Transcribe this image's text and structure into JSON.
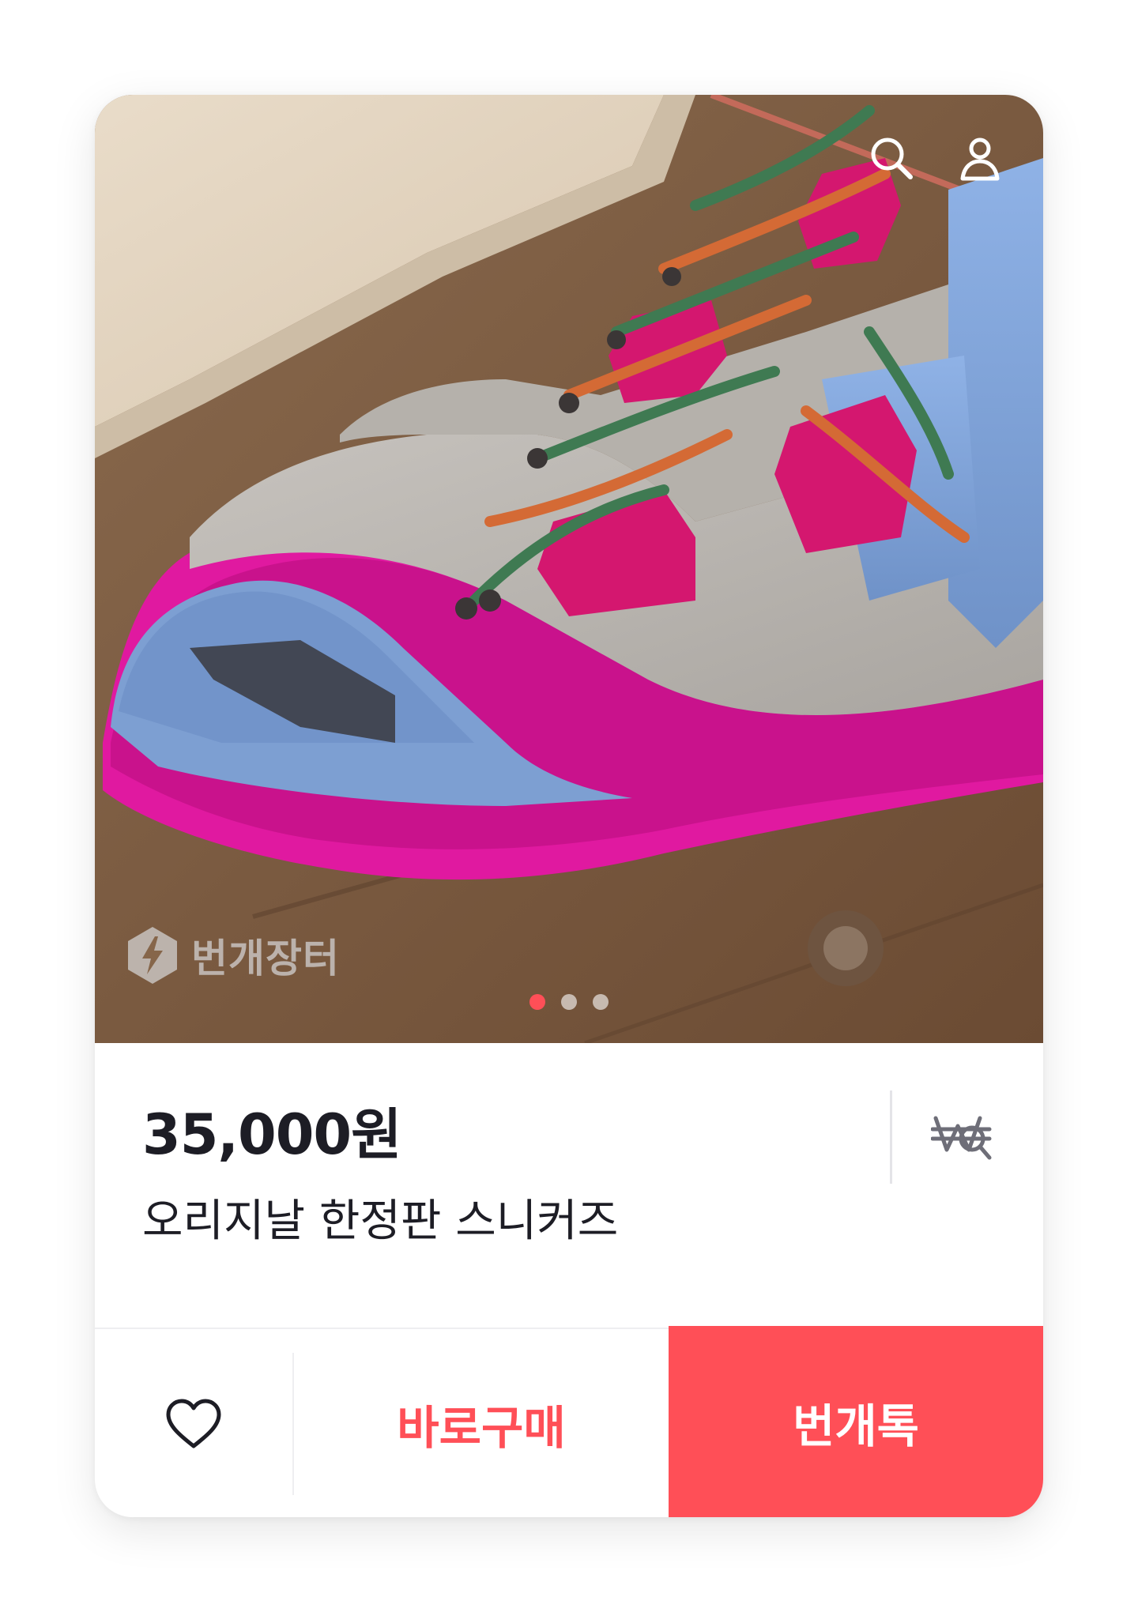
{
  "product": {
    "price": "35,000원",
    "title": "오리지날 한정판 스니커즈",
    "image_alt": "shoe-photo"
  },
  "watermark": {
    "text": "번개장터"
  },
  "carousel": {
    "count": 3,
    "active_index": 0
  },
  "icons": {
    "top_left": "search-icon",
    "top_right": "user-icon",
    "price_offer": "won-offer-icon",
    "like": "heart-icon"
  },
  "actions": {
    "buy_now_label": "바로구매",
    "chat_label": "번개톡"
  },
  "colors": {
    "accent": "#ff4f57",
    "text": "#1d1d25"
  }
}
